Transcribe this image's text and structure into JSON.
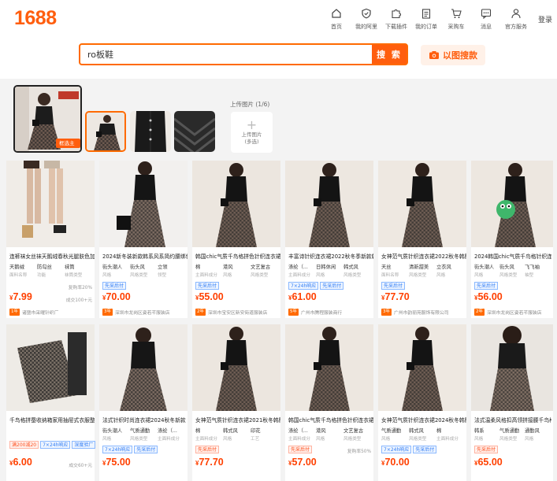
{
  "header": {
    "logo": "1688",
    "nav": [
      {
        "label": "首页",
        "icon": "home-icon"
      },
      {
        "label": "我的阿里",
        "icon": "shield-icon"
      },
      {
        "label": "下载插件",
        "icon": "puzzle-icon"
      },
      {
        "label": "我的订单",
        "icon": "clipboard-icon"
      },
      {
        "label": "采购车",
        "icon": "cart-icon"
      },
      {
        "label": "消息",
        "icon": "message-icon"
      },
      {
        "label": "官方服务",
        "icon": "user-icon"
      }
    ],
    "login": "登录"
  },
  "search": {
    "value": "ro板鞋",
    "button": "搜 索",
    "image_search": "以图搜款"
  },
  "upload": {
    "box_tag": "框选主体",
    "label": "上传图片 (1/6)",
    "add_line1": "上传图片",
    "add_line2": "(多选)"
  },
  "products": [
    {
      "title": "连裤袜女丝袜天鹅绒春秋光腿肤色加",
      "attrs": [
        [
          "天鹅绒",
          "面料名称"
        ],
        [
          "防勾丝",
          "功能"
        ],
        [
          "袜筒",
          "袜筒类型"
        ]
      ],
      "tags": [],
      "extra": "复购率20%",
      "price": "7.99",
      "sold": "成交100+元",
      "badge": "1年",
      "shop": "诸暨市采曜针织厂"
    },
    {
      "title": "2024新冬装新款韩系风系简约腰绑色",
      "attrs": [
        [
          "街头潮人",
          "风格"
        ],
        [
          "街头风",
          "风格类型"
        ],
        [
          "立领",
          "领型"
        ]
      ],
      "tags": [
        [
          "先采后付",
          "blue"
        ]
      ],
      "extra": "",
      "price": "70.00",
      "sold": "",
      "badge": "3年",
      "shop": "深圳市龙岗区姿若芊服装店"
    },
    {
      "title": "韩国chic气质千鸟格拼色针织连衣裙",
      "attrs": [
        [
          "棉",
          "主面料成分"
        ],
        [
          "港风",
          "风格"
        ],
        [
          "文艺复古",
          "风格类型"
        ]
      ],
      "tags": [
        [
          "先采后付",
          "blue"
        ]
      ],
      "extra": "",
      "price": "55.00",
      "sold": "",
      "badge": "2年",
      "shop": "深圳市宝安区新安街道服装店"
    },
    {
      "title": "丰富诗针织连衣裙2022秋冬季新款韩版",
      "attrs": [
        [
          "涤纶（...",
          "主面料成分"
        ],
        [
          "日韩休闲",
          "风格"
        ],
        [
          "韩式风",
          "风格类型"
        ]
      ],
      "tags": [
        [
          "7×24h响应",
          "blue"
        ],
        [
          "先采后付",
          "blue"
        ]
      ],
      "extra": "",
      "price": "61.00",
      "sold": "",
      "badge": "5年",
      "shop": "广州市腾程服装商行"
    },
    {
      "title": "女神范气质针织连衣裙2022秋冬韩版",
      "attrs": [
        [
          "天丝",
          "面料名称"
        ],
        [
          "清新甜美",
          "风格类型"
        ],
        [
          "立衣风",
          "风格"
        ]
      ],
      "tags": [
        [
          "先采后付",
          "blue"
        ]
      ],
      "extra": "",
      "price": "77.70",
      "sold": "",
      "badge": "3年",
      "shop": "广州市韵丽苑服饰有限公司"
    },
    {
      "title": "2024韩国chic气质千鸟格针织连衣",
      "attrs": [
        [
          "街头潮人",
          "风格"
        ],
        [
          "街头风",
          "风格类型"
        ],
        [
          "飞飞袖",
          "袖型"
        ]
      ],
      "tags": [
        [
          "先采后付",
          "blue"
        ]
      ],
      "extra": "",
      "price": "56.00",
      "sold": "",
      "badge": "2年",
      "shop": "深圳市龙岗区姿若芊服装店"
    },
    {
      "title": "千鸟格拼蚕收纳箱家用抽屉式衣服整",
      "attrs": [],
      "tags": [
        [
          "满200减20",
          "red"
        ],
        [
          "7×24h响应",
          "blue"
        ],
        [
          "深度验厂",
          "blue"
        ]
      ],
      "extra": "",
      "price": "6.00",
      "sold": "成交60+元",
      "badge": "",
      "shop": ""
    },
    {
      "title": "法式针织时尚连衣裙2024秋冬新款",
      "attrs": [
        [
          "街头潮人",
          "风格"
        ],
        [
          "气质通勤",
          "风格类型"
        ],
        [
          "涤纶（...",
          "主面料成分"
        ]
      ],
      "tags": [
        [
          "7×24h响应",
          "blue"
        ],
        [
          "先采后付",
          "blue"
        ]
      ],
      "extra": "",
      "price": "75.00",
      "sold": "",
      "badge": "",
      "shop": ""
    },
    {
      "title": "女神范气质针织连衣裙2021秋冬韩版",
      "attrs": [
        [
          "棉",
          "主面料成分"
        ],
        [
          "韩式风",
          "风格"
        ],
        [
          "印花",
          "工艺"
        ]
      ],
      "tags": [
        [
          "先采后付",
          "blue"
        ]
      ],
      "extra": "",
      "price": "77.70",
      "sold": "",
      "badge": "",
      "shop": ""
    },
    {
      "title": "韩国chic气质千鸟格拼色针织连衣裙",
      "attrs": [
        [
          "涤纶（...",
          "主面料成分"
        ],
        [
          "港风",
          "风格"
        ],
        [
          "文艺复古",
          "风格类型"
        ]
      ],
      "tags": [
        [
          "先采后付",
          "blue"
        ]
      ],
      "extra": "复购率50%",
      "price": "57.00",
      "sold": "",
      "badge": "",
      "shop": ""
    },
    {
      "title": "女神范气质针织连衣裙2024秋冬韩版",
      "attrs": [
        [
          "气质通勤",
          "风格"
        ],
        [
          "韩式风",
          "风格类型"
        ],
        [
          "棉",
          "主面料成分"
        ]
      ],
      "tags": [
        [
          "7×24h响应",
          "blue"
        ],
        [
          "先采后付",
          "blue"
        ]
      ],
      "extra": "",
      "price": "70.00",
      "sold": "",
      "badge": "",
      "shop": ""
    },
    {
      "title": "法式温柔风格扣高领拼接腰千鸟格",
      "attrs": [
        [
          "韩系",
          "风格"
        ],
        [
          "气质通勤",
          "风格类型"
        ],
        [
          "通勤风",
          "风格"
        ]
      ],
      "tags": [
        [
          "先采后付",
          "blue"
        ]
      ],
      "extra": "",
      "price": "65.00",
      "sold": "",
      "badge": "",
      "shop": ""
    }
  ],
  "colors": {
    "accent": "#ff5e0e",
    "price": "#ff4000",
    "tag_blue": "#2f7bf5"
  }
}
